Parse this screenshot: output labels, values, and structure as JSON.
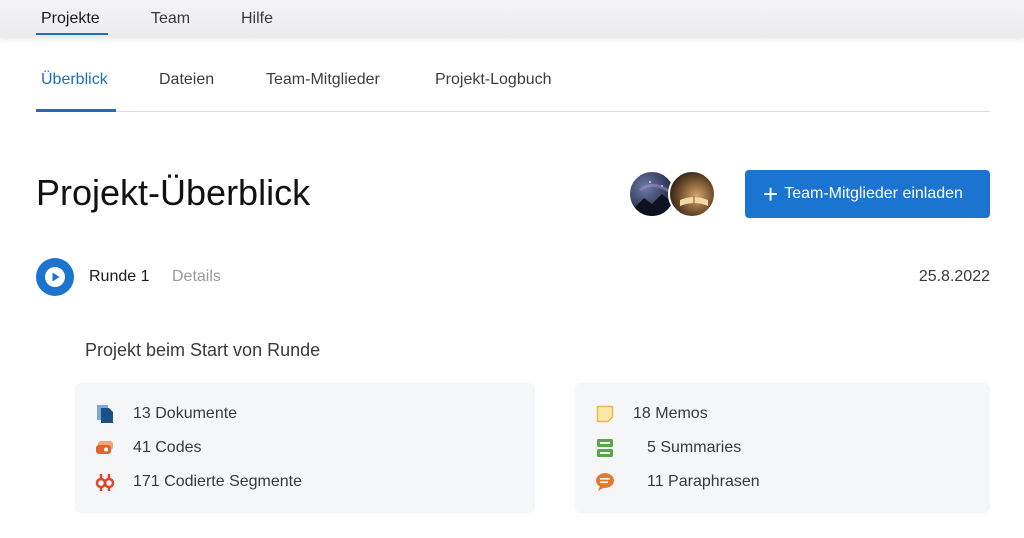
{
  "topnav": {
    "items": [
      {
        "label": "Projekte",
        "active": true
      },
      {
        "label": "Team",
        "active": false
      },
      {
        "label": "Hilfe",
        "active": false
      }
    ]
  },
  "tabs": {
    "items": [
      {
        "label": "Überblick",
        "active": true
      },
      {
        "label": "Dateien",
        "active": false
      },
      {
        "label": "Team-Mitglieder",
        "active": false
      },
      {
        "label": "Projekt-Logbuch",
        "active": false
      }
    ]
  },
  "header": {
    "title": "Projekt-Überblick",
    "invite_label": "Team-Mitglieder einladen"
  },
  "round": {
    "label": "Runde 1",
    "details_label": "Details",
    "date": "25.8.2022"
  },
  "section": {
    "heading": "Projekt beim Start von Runde"
  },
  "stats_left": [
    {
      "text": "13 Dokumente",
      "icon": "document-icon"
    },
    {
      "text": "41 Codes",
      "icon": "code-icon"
    },
    {
      "text": "171 Codierte Segmente",
      "icon": "coded-segment-icon"
    }
  ],
  "stats_right": [
    {
      "text": "18 Memos",
      "icon": "memo-icon"
    },
    {
      "text": "5 Summaries",
      "icon": "summary-icon"
    },
    {
      "text": "11 Paraphrasen",
      "icon": "paraphrase-icon"
    }
  ],
  "colors": {
    "accent": "#1a74d0",
    "document": "#1e4f86",
    "code": "#e0662a",
    "memo": "#f7d67a",
    "summary": "#58a84a",
    "paraphrase": "#e7772b"
  }
}
